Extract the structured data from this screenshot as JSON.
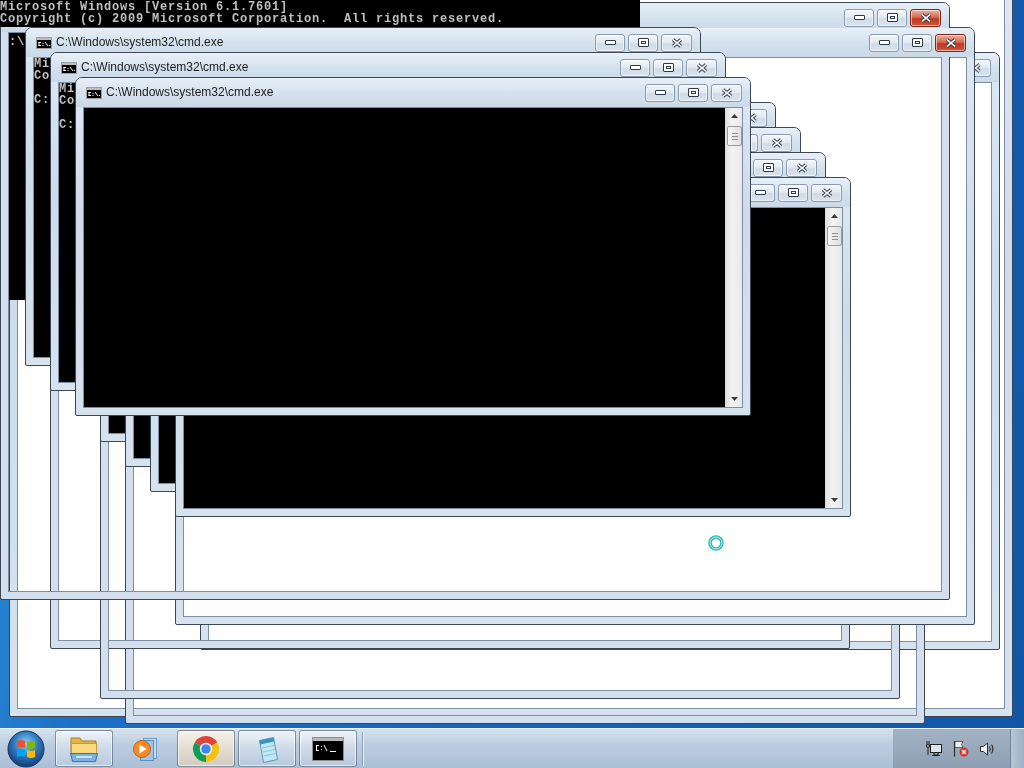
{
  "console_banner": {
    "output": [
      "Microsoft Windows [Version 6.1.7601]",
      "Copyright (c) 2009 Microsoft Corporation.  All rights reserved."
    ]
  },
  "windows": [
    {
      "kind": "blank"
    },
    {
      "kind": "blank",
      "buttons": [
        {
          "kind": "close",
          "hot": false
        }
      ]
    },
    {
      "kind": "outline"
    },
    {
      "kind": "outline"
    },
    {
      "kind": "outline"
    },
    {
      "kind": "blank",
      "buttons": [
        {
          "kind": "minimize",
          "hot": false
        },
        {
          "kind": "maximize",
          "hot": false
        },
        {
          "kind": "close",
          "hot": true
        }
      ]
    },
    {
      "kind": "outline",
      "buttons": [
        {
          "kind": "minimize",
          "hot": false
        },
        {
          "kind": "maximize",
          "hot": false
        },
        {
          "kind": "close",
          "hot": true
        }
      ],
      "output": [
        ":\\"
      ]
    },
    {
      "kind": "console",
      "title": "C:\\Windows\\system32\\cmd.exe",
      "buttons": [
        {
          "kind": "minimize",
          "hot": false
        },
        {
          "kind": "maximize",
          "hot": false
        },
        {
          "kind": "close",
          "hot": false
        }
      ],
      "output": [
        "Mi",
        "Co"
      ],
      "prompt": "C:"
    },
    {
      "kind": "console",
      "title": "C:\\Windows\\system32\\cmd.exe",
      "buttons": [
        {
          "kind": "minimize",
          "hot": false
        },
        {
          "kind": "maximize",
          "hot": false
        },
        {
          "kind": "close",
          "hot": false
        }
      ],
      "output": [
        "Mi",
        "Co"
      ],
      "prompt": "C:"
    },
    {
      "kind": "console",
      "buttons": [
        {
          "kind": "close",
          "hot": false
        }
      ]
    },
    {
      "kind": "console",
      "buttons": [
        {
          "kind": "maximize",
          "hot": false
        },
        {
          "kind": "close",
          "hot": false
        }
      ]
    },
    {
      "kind": "console",
      "buttons": [
        {
          "kind": "maximize",
          "hot": false
        },
        {
          "kind": "close",
          "hot": false
        }
      ]
    },
    {
      "kind": "console",
      "buttons": [
        {
          "kind": "minimize",
          "hot": false
        },
        {
          "kind": "maximize",
          "hot": false
        },
        {
          "kind": "close",
          "hot": false
        }
      ],
      "scrollbar": true
    },
    {
      "kind": "console",
      "title": "C:\\Windows\\system32\\cmd.exe",
      "buttons": [
        {
          "kind": "minimize",
          "hot": false
        },
        {
          "kind": "maximize",
          "hot": false
        },
        {
          "kind": "close",
          "hot": false
        }
      ],
      "scrollbar": true
    }
  ],
  "taskbar": {
    "items": [
      {
        "kind": "folder",
        "running": true,
        "highlighted": false
      },
      {
        "kind": "media_player",
        "running": false,
        "highlighted": false
      },
      {
        "kind": "browser",
        "running": true,
        "highlighted": true
      },
      {
        "kind": "notepad",
        "running": true,
        "highlighted": false
      },
      {
        "kind": "console",
        "running": true,
        "highlighted": false
      }
    ]
  }
}
